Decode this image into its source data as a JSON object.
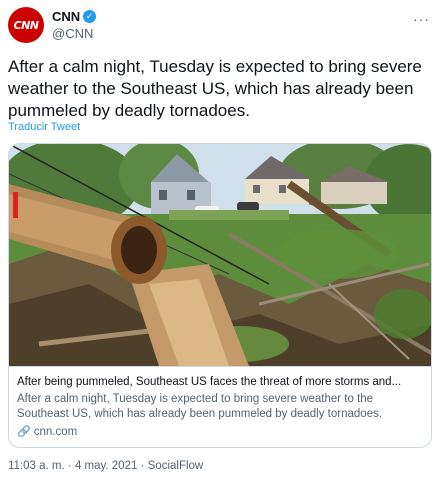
{
  "author": {
    "name": "CNN",
    "handle": "@CNN",
    "avatar_text": "CNN"
  },
  "menu_icon": "more-horizontal-icon",
  "tweet": {
    "text": "After a calm night, Tuesday is expected to bring severe weather to the Southeast US, which has already been pummeled by deadly tornadoes.",
    "translate_label": "Traducir Tweet"
  },
  "card": {
    "title": "After being pummeled, Southeast US faces the threat of more storms and...",
    "description": "After a calm night, Tuesday is expected to bring severe weather to the Southeast US, which has already been pummeled by deadly tornadoes.",
    "domain": "cnn.com"
  },
  "meta": {
    "time": "11:03 a. m.",
    "separator": "·",
    "date": "4 may. 2021",
    "source": "SocialFlow"
  },
  "colors": {
    "brand_red": "#cc0000",
    "verified_blue": "#1d9bf0",
    "link_blue": "#1d9bf0",
    "secondary_text": "#536471"
  }
}
